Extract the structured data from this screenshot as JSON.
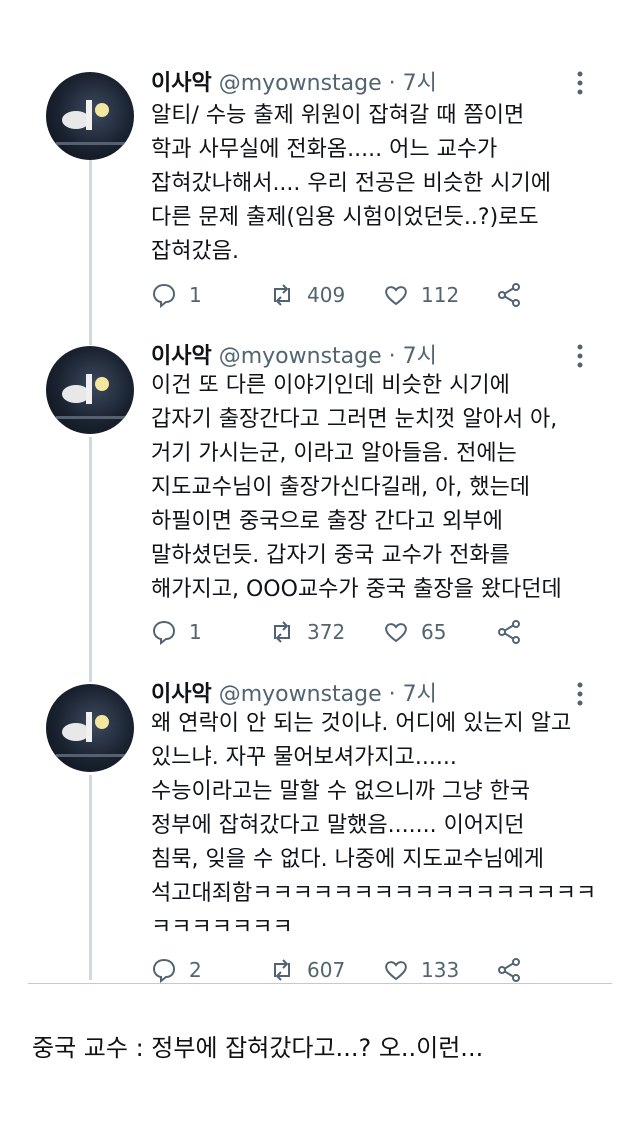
{
  "tweets": [
    {
      "name": "이사악",
      "handle": "@myownstage · 7시",
      "lines": [
        "알티/ 수능 출제 위원이 잡혀갈 때 쯤이면",
        "학과 사무실에 전화옴..... 어느 교수가",
        "잡혀갔나해서.... 우리 전공은 비슷한 시기에",
        "다른 문제 출제(임용 시험이었던듯..?)로도",
        "잡혀갔음."
      ],
      "replies": "1",
      "retweets": "409",
      "likes": "112"
    },
    {
      "name": "이사악",
      "handle": "@myownstage · 7시",
      "lines": [
        "이건 또 다른 이야기인데 비슷한 시기에",
        "갑자기 출장간다고 그러면 눈치껏 알아서 아,",
        "거기 가시는군, 이라고 알아들음. 전에는",
        "지도교수님이 출장가신다길래, 아, 했는데",
        "하필이면 중국으로 출장 간다고 외부에",
        "말하셨던듯. 갑자기 중국 교수가 전화를",
        "해가지고, OOO교수가 중국 출장을 왔다던데"
      ],
      "replies": "1",
      "retweets": "372",
      "likes": "65"
    },
    {
      "name": "이사악",
      "handle": "@myownstage · 7시",
      "lines": [
        "왜 연락이 안 되는 것이냐. 어디에 있는지 알고",
        "있느냐. 자꾸 물어보셔가지고......",
        "수능이라고는 말할 수 없으니까 그냥 한국",
        "정부에 잡혀갔다고 말했음....... 이어지던",
        "침묵, 잊을 수 없다. 나중에 지도교수님에게",
        "석고대죄함ㅋㅋㅋㅋㅋㅋㅋㅋㅋㅋㅋㅋㅋㅋㅋㅋㅋ",
        "ㅋㅋㅋㅋㅋㅋㅋ"
      ],
      "replies": "2",
      "retweets": "607",
      "likes": "133"
    }
  ],
  "caption": "중국 교수 : 정부에 잡혀갔다고...? 오..이런...",
  "icons": {
    "more": "more-vertical-icon",
    "reply": "reply-icon",
    "retweet": "retweet-icon",
    "like": "heart-icon",
    "share": "share-icon"
  },
  "colors": {
    "text": "#0f1419",
    "secondary": "#536471",
    "thread_line": "#cfd9de"
  }
}
